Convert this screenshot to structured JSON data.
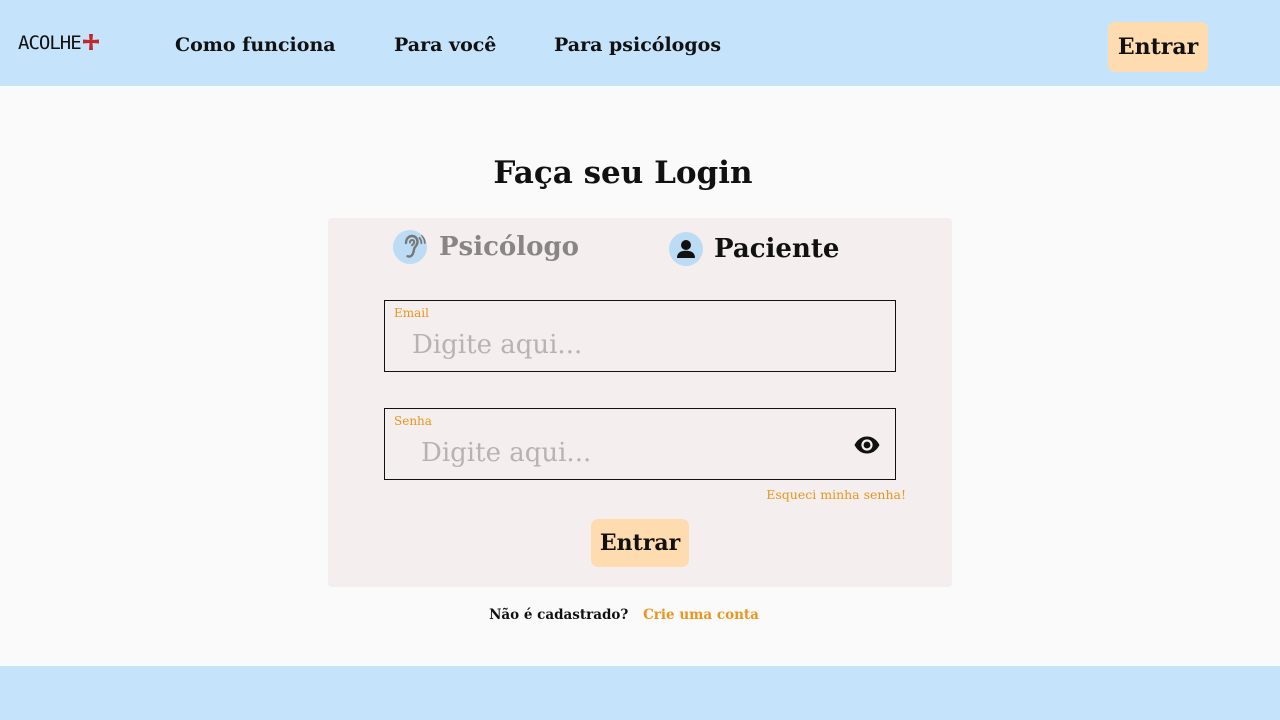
{
  "header": {
    "logo_text": "ACOLHE",
    "nav": [
      {
        "label": "Como funciona"
      },
      {
        "label": "Para você"
      },
      {
        "label": "Para psicólogos"
      }
    ],
    "login_label": "Entrar"
  },
  "login": {
    "title": "Faça seu Login",
    "tabs": [
      {
        "label": "Psicólogo",
        "icon": "ear-icon",
        "selected": false
      },
      {
        "label": "Paciente",
        "icon": "user-icon",
        "selected": true
      }
    ],
    "email": {
      "label": "Email",
      "placeholder": "Digite aqui...",
      "value": ""
    },
    "password": {
      "label": "Senha",
      "placeholder": "Digite aqui...",
      "value": ""
    },
    "forgot_label": "Esqueci minha senha!",
    "submit_label": "Entrar",
    "signup_question": "Não é cadastrado?",
    "signup_link": "Crie uma conta"
  },
  "colors": {
    "header_bg": "#c5e4fb",
    "page_bg": "#fafafa",
    "card_bg": "#f4eeee",
    "button_bg": "#ffdcaf",
    "accent": "#e8961e",
    "logo_plus": "#c0282d"
  }
}
